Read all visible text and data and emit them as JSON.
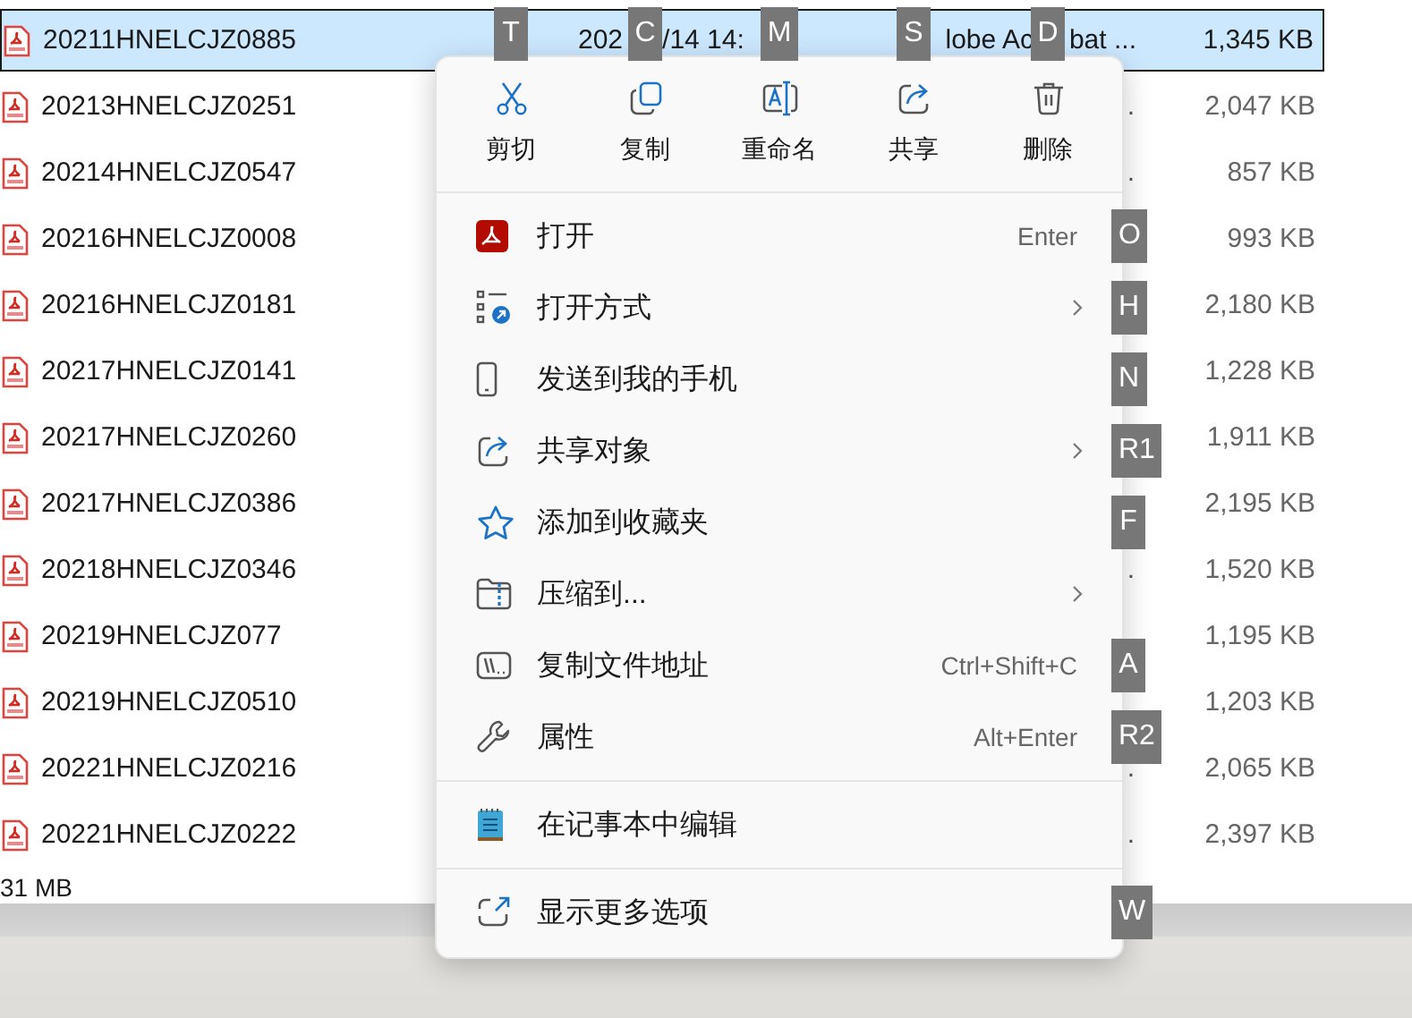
{
  "files": [
    {
      "name": "20211HNELCJZ0885",
      "size": "1,345 KB",
      "selected": true,
      "date_parts": [
        "202",
        "/14 14:"
      ],
      "type_parts": [
        "lobe Ac",
        "bat ..."
      ]
    },
    {
      "name": "20213HNELCJZ0251",
      "size": "2,047 KB",
      "selected": false,
      "type_parts": [
        "."
      ]
    },
    {
      "name": "20214HNELCJZ0547",
      "size": "857 KB",
      "selected": false,
      "type_parts": [
        "."
      ]
    },
    {
      "name": "20216HNELCJZ0008",
      "size": "993 KB",
      "selected": false
    },
    {
      "name": "20216HNELCJZ0181",
      "size": "2,180 KB",
      "selected": false
    },
    {
      "name": "20217HNELCJZ0141",
      "size": "1,228 KB",
      "selected": false
    },
    {
      "name": "20217HNELCJZ0260",
      "size": "1,911 KB",
      "selected": false
    },
    {
      "name": "20217HNELCJZ0386",
      "size": "2,195 KB",
      "selected": false
    },
    {
      "name": "20218HNELCJZ0346",
      "size": "1,520 KB",
      "selected": false,
      "type_parts": [
        "."
      ]
    },
    {
      "name": "20219HNELCJZ077",
      "size": "1,195 KB",
      "selected": false
    },
    {
      "name": "20219HNELCJZ0510",
      "size": "1,203 KB",
      "selected": false
    },
    {
      "name": "20221HNELCJZ0216",
      "size": "2,065 KB",
      "selected": false,
      "type_parts": [
        "."
      ]
    },
    {
      "name": "20221HNELCJZ0222",
      "size": "2,397 KB",
      "selected": false,
      "type_parts": [
        "."
      ]
    }
  ],
  "status_bar": {
    "text": "31 MB"
  },
  "context_menu": {
    "toolbar": [
      {
        "label": "剪切",
        "kind": "cut",
        "keytip": "T"
      },
      {
        "label": "复制",
        "kind": "copy",
        "keytip": "C"
      },
      {
        "label": "重命名",
        "kind": "rename",
        "keytip": "M"
      },
      {
        "label": "共享",
        "kind": "share",
        "keytip": "S"
      },
      {
        "label": "删除",
        "kind": "delete",
        "keytip": "D"
      }
    ],
    "groups": [
      {
        "items": [
          {
            "label": "打开",
            "kind": "acrobat",
            "shortcut": "Enter",
            "submenu": false,
            "keytip": "O"
          },
          {
            "label": "打开方式",
            "kind": "open-with",
            "submenu": true,
            "keytip": "H"
          },
          {
            "label": "发送到我的手机",
            "kind": "phone",
            "submenu": false,
            "keytip": "N"
          },
          {
            "label": "共享对象",
            "kind": "share",
            "submenu": true,
            "keytip": "R1"
          },
          {
            "label": "添加到收藏夹",
            "kind": "star",
            "submenu": false,
            "keytip": "F"
          },
          {
            "label": "压缩到...",
            "kind": "zip",
            "submenu": true
          },
          {
            "label": "复制文件地址",
            "kind": "path",
            "shortcut": "Ctrl+Shift+C",
            "submenu": false,
            "keytip": "A"
          },
          {
            "label": "属性",
            "kind": "wrench",
            "shortcut": "Alt+Enter",
            "submenu": false,
            "keytip": "R2"
          }
        ]
      },
      {
        "items": [
          {
            "label": "在记事本中编辑",
            "kind": "notepad",
            "submenu": false
          }
        ]
      },
      {
        "items": [
          {
            "label": "显示更多选项",
            "kind": "more",
            "submenu": false,
            "keytip": "W"
          }
        ]
      }
    ]
  }
}
